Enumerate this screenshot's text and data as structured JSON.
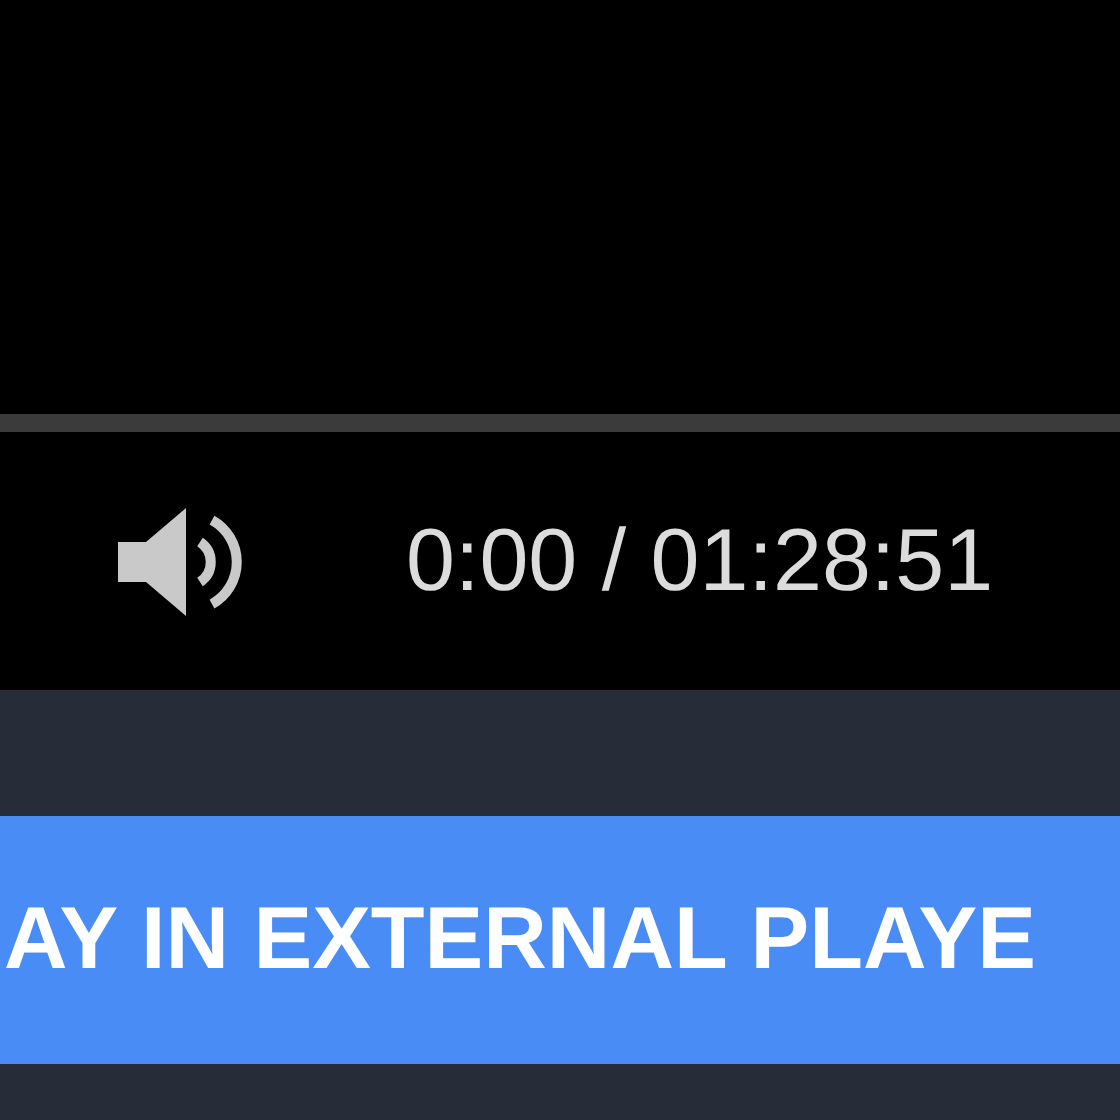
{
  "player": {
    "progress": {
      "level": 0
    },
    "time": "0:00 / 01:28:51",
    "muted": false
  },
  "external_button": {
    "label": "AY IN EXTERNAL PLAYE"
  }
}
